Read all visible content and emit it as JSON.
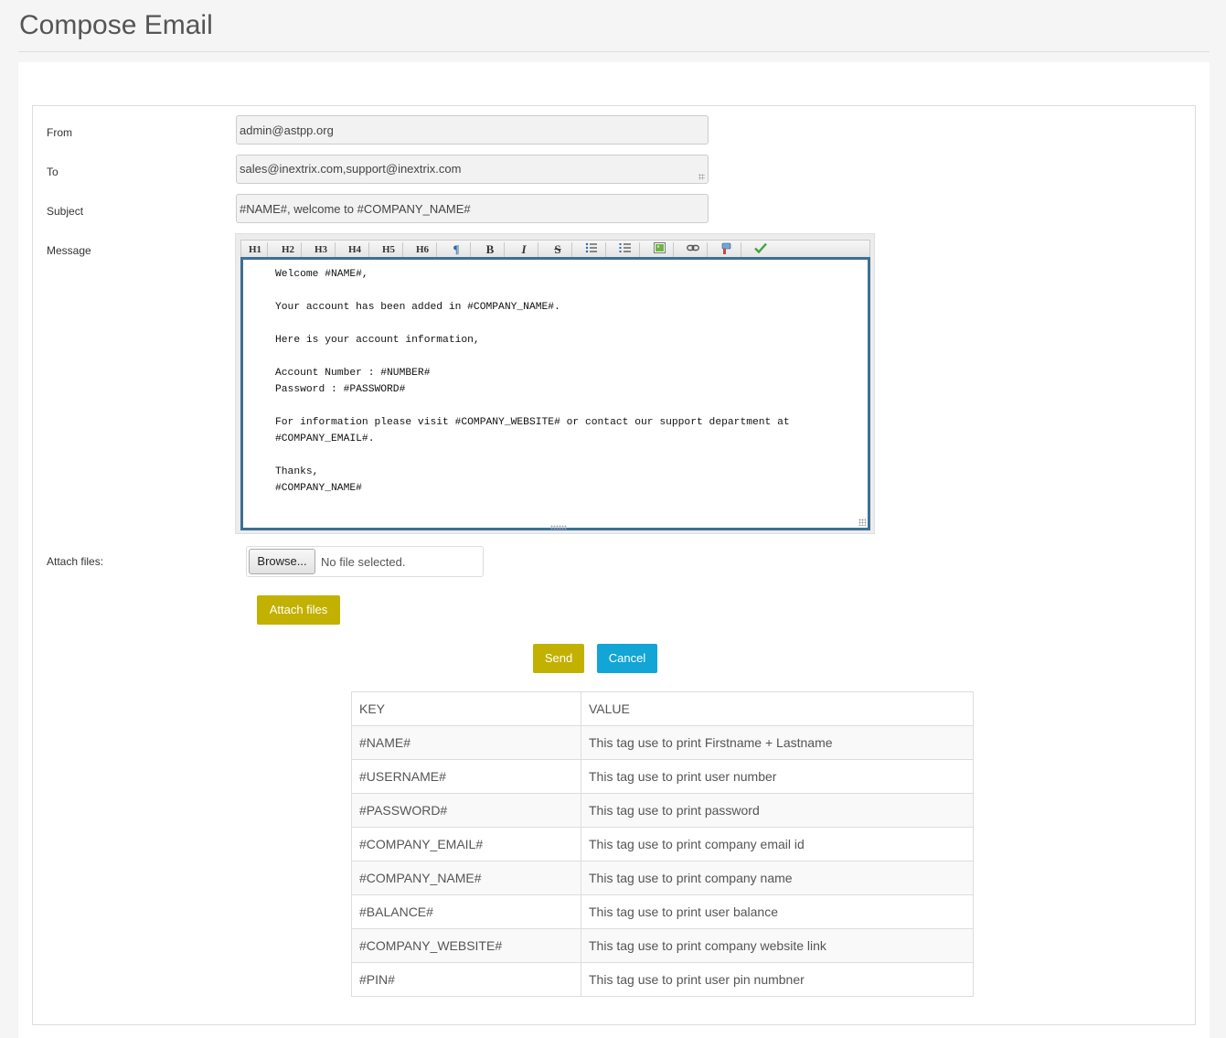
{
  "page": {
    "title": "Compose Email"
  },
  "form": {
    "from_label": "From",
    "from_value": "admin@astpp.org",
    "to_label": "To",
    "to_value": "sales@inextrix.com,support@inextrix.com",
    "subject_label": "Subject",
    "subject_value": "#NAME#, welcome to #COMPANY_NAME#",
    "message_label": "Message",
    "message_body": "Welcome #NAME#,\n\nYour account has been added in #COMPANY_NAME#.\n\nHere is your account information,\n\nAccount Number : #NUMBER#\nPassword : #PASSWORD#\n\nFor information please visit #COMPANY_WEBSITE# or contact our support department at\n#COMPANY_EMAIL#.\n\nThanks,\n#COMPANY_NAME#",
    "attach_label": "Attach files:",
    "browse_label": "Browse...",
    "file_status": "No file selected.",
    "attach_button": "Attach files",
    "send_button": "Send",
    "cancel_button": "Cancel"
  },
  "toolbar": {
    "h1": "H1",
    "h2": "H2",
    "h3": "H3",
    "h4": "H4",
    "h5": "H5",
    "h6": "H6",
    "paragraph": "¶",
    "bold": "B",
    "italic": "I",
    "strike": "S",
    "icons": [
      "h1-icon",
      "h2-icon",
      "h3-icon",
      "h4-icon",
      "h5-icon",
      "h6-icon",
      "paragraph-icon",
      "bold-icon",
      "italic-icon",
      "strikethrough-icon",
      "unordered-list-icon",
      "ordered-list-icon",
      "image-icon",
      "link-icon",
      "clean-icon",
      "check-icon"
    ]
  },
  "colors": {
    "accent_olive": "#c2b100",
    "accent_blue": "#12a5d5",
    "editor_border": "#3e6f96"
  },
  "tags_table": {
    "headers": {
      "key": "KEY",
      "value": "VALUE"
    },
    "rows": [
      {
        "key": "#NAME#",
        "value": "This tag use to print Firstname + Lastname"
      },
      {
        "key": "#USERNAME#",
        "value": "This tag use to print user number"
      },
      {
        "key": "#PASSWORD#",
        "value": "This tag use to print password"
      },
      {
        "key": "#COMPANY_EMAIL#",
        "value": "This tag use to print company email id"
      },
      {
        "key": "#COMPANY_NAME#",
        "value": "This tag use to print company name"
      },
      {
        "key": "#BALANCE#",
        "value": "This tag use to print user balance"
      },
      {
        "key": "#COMPANY_WEBSITE#",
        "value": "This tag use to print company website link"
      },
      {
        "key": "#PIN#",
        "value": "This tag use to print user pin numbner"
      }
    ]
  }
}
